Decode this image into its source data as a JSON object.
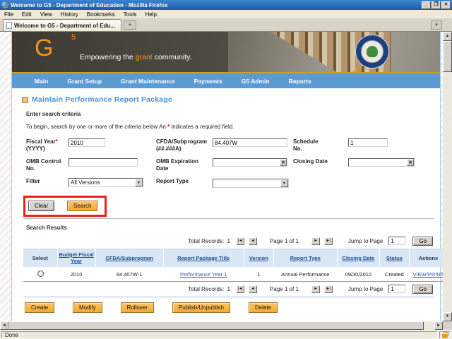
{
  "window": {
    "title": "Welcome to G5 - Department of Education - Mozilla Firefox",
    "menu_items": [
      "File",
      "Edit",
      "View",
      "History",
      "Bookmarks",
      "Tools",
      "Help"
    ],
    "tab_title": "Welcome to G5 - Department of Edu...",
    "buttons": {
      "minimize": "_",
      "restore": "❐",
      "close": "×",
      "new_tab": "+",
      "all_tabs": "▾"
    },
    "status_text": "Done"
  },
  "banner": {
    "logo_g": "G",
    "logo_5": "5",
    "tagline_pre": "Empowering the ",
    "tagline_highlight": "grant",
    "tagline_post": " community."
  },
  "nav": {
    "items": [
      "Main",
      "Grant Setup",
      "Grant Maintenance",
      "Payments",
      "G5 Admin",
      "Reports"
    ]
  },
  "page": {
    "title": "Maintain Performance Report Package",
    "section_heading": "Enter search criteria",
    "instructions_pre": "To begin, search by one or more of the criteria below An ",
    "instructions_star": "*",
    "instructions_post": " indicates a required field."
  },
  "form": {
    "fiscal_year": {
      "label": "Fiscal Year",
      "required": "*",
      "sub": "(YYYY)",
      "value": "2010"
    },
    "cfda": {
      "label": "CFDA/Subprogram",
      "sub": "(##.###A)",
      "value": "84.407W"
    },
    "schedule": {
      "label": "Schedule",
      "sub": "No.",
      "value": "1"
    },
    "omb_control": {
      "label": "OMB Control",
      "sub": "No.",
      "value": ""
    },
    "omb_expiration": {
      "label": "OMB Expiration",
      "sub": "Date",
      "value": ""
    },
    "closing_date": {
      "label": "Closing Date",
      "value": ""
    },
    "filter": {
      "label": "Filter",
      "value": "All Versions"
    },
    "report_type": {
      "label": "Report Type",
      "value": ""
    },
    "clear_button": "Clear",
    "search_button": "Search"
  },
  "results": {
    "heading": "Search Results",
    "pagination": {
      "total_label": "Total Records:",
      "total_value": "1",
      "page_label": "Page 1 of 1",
      "jump_label": "Jump to Page",
      "jump_value": "1",
      "go_button": "Go"
    },
    "columns": [
      "Select",
      "Budget Fiscal Year",
      "CFDA/Subprogram",
      "Report Package Title",
      "Version",
      "Report Type",
      "Closing Date",
      "Status",
      "Actions"
    ],
    "rows": [
      {
        "budget_fiscal_year": "2010",
        "cfda": "84.407W-1",
        "title": "Performance Year 1",
        "version": "1",
        "report_type": "Annual Performance",
        "closing_date": "09/30/2010",
        "status": "Created",
        "action": "VIEW/PRINT"
      }
    ]
  },
  "actions": {
    "buttons": [
      "Create",
      "Modify",
      "Rollover",
      "Publish/Unpublish",
      "Delete"
    ]
  },
  "icons": {
    "first": "|◄",
    "prev": "◄",
    "next": "►",
    "last": "►|",
    "dropdown": "▼",
    "calendar": "▦",
    "scroll_up": "▲",
    "scroll_down": "▼",
    "scroll_left": "◄",
    "scroll_right": "►"
  },
  "colors": {
    "accent_orange": "#f7941d",
    "nav_blue": "#5b9ad2",
    "table_header_bg": "#d9e6f4",
    "link_blue": "#2b57c5",
    "highlight_red": "#e8231e",
    "button_orange": "#f5a832"
  }
}
